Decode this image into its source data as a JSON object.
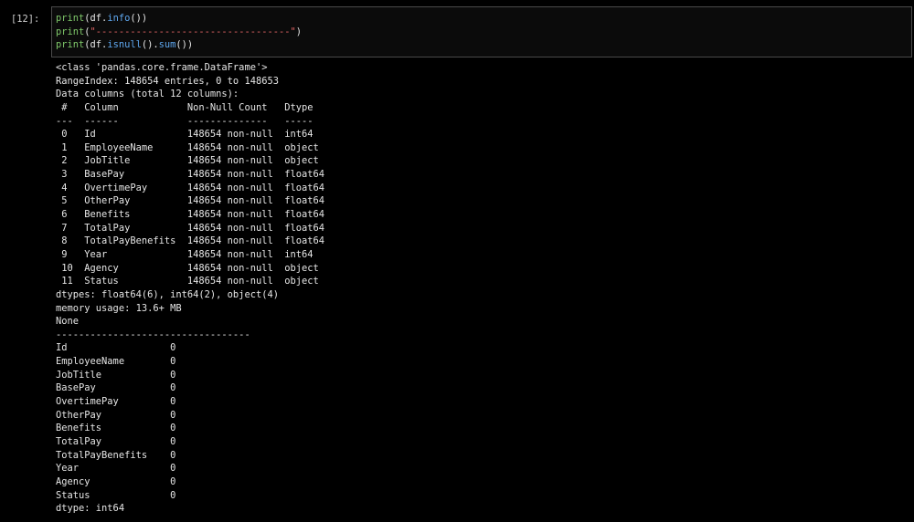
{
  "cell": {
    "prompt": "[12]:",
    "code_lines": [
      [
        {
          "t": "print",
          "c": "kw"
        },
        {
          "t": "(df.",
          "c": "plain"
        },
        {
          "t": "info",
          "c": "attr"
        },
        {
          "t": "())",
          "c": "plain"
        }
      ],
      [
        {
          "t": "print",
          "c": "kw"
        },
        {
          "t": "(",
          "c": "plain"
        },
        {
          "t": "\"----------------------------------\"",
          "c": "str"
        },
        {
          "t": ")",
          "c": "plain"
        }
      ],
      [
        {
          "t": "print",
          "c": "kw"
        },
        {
          "t": "(df.",
          "c": "plain"
        },
        {
          "t": "isnull",
          "c": "attr"
        },
        {
          "t": "().",
          "c": "plain"
        },
        {
          "t": "sum",
          "c": "attr"
        },
        {
          "t": "())",
          "c": "plain"
        }
      ]
    ],
    "output_lines": [
      "<class 'pandas.core.frame.DataFrame'>",
      "RangeIndex: 148654 entries, 0 to 148653",
      "Data columns (total 12 columns):",
      " #   Column            Non-Null Count   Dtype  ",
      "---  ------            --------------   -----  ",
      " 0   Id                148654 non-null  int64  ",
      " 1   EmployeeName      148654 non-null  object ",
      " 2   JobTitle          148654 non-null  object ",
      " 3   BasePay           148654 non-null  float64",
      " 4   OvertimePay       148654 non-null  float64",
      " 5   OtherPay          148654 non-null  float64",
      " 6   Benefits          148654 non-null  float64",
      " 7   TotalPay          148654 non-null  float64",
      " 8   TotalPayBenefits  148654 non-null  float64",
      " 9   Year              148654 non-null  int64  ",
      " 10  Agency            148654 non-null  object ",
      " 11  Status            148654 non-null  object ",
      "dtypes: float64(6), int64(2), object(4)",
      "memory usage: 13.6+ MB",
      "None",
      "----------------------------------",
      "Id                  0",
      "EmployeeName        0",
      "JobTitle            0",
      "BasePay             0",
      "OvertimePay         0",
      "OtherPay            0",
      "Benefits            0",
      "TotalPay            0",
      "TotalPayBenefits    0",
      "Year                0",
      "Agency              0",
      "Status              0",
      "dtype: int64"
    ]
  },
  "colors": {
    "background": "#000000",
    "keyword": "#7fc86a",
    "attribute": "#5fa8f0",
    "string": "#e06464",
    "text": "#e6e6e6"
  }
}
